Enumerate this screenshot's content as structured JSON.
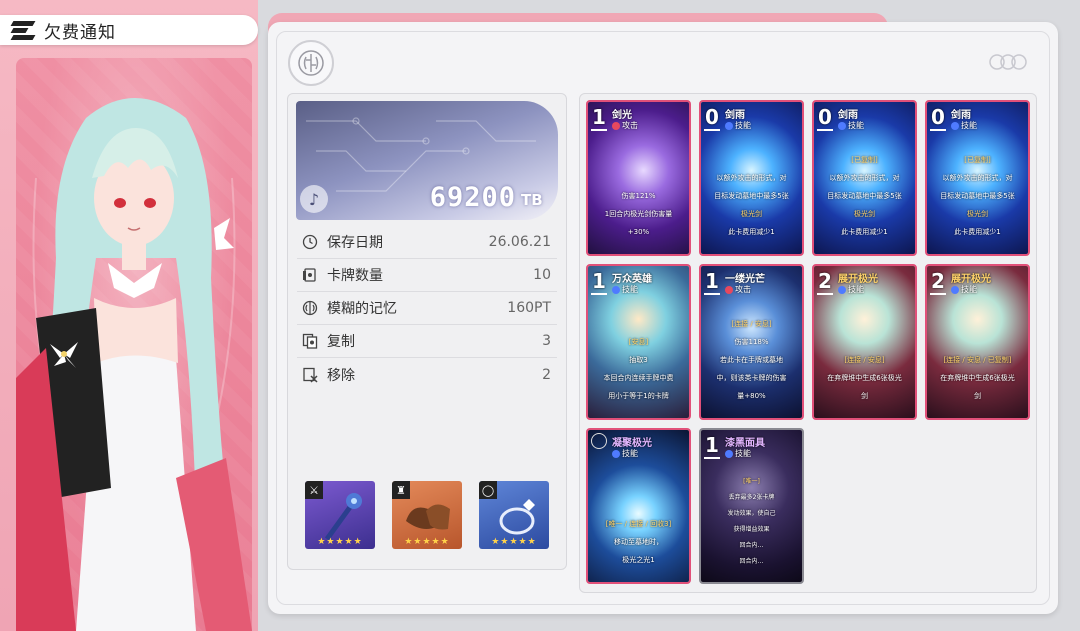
{
  "title_bar": {
    "title": "欠费通知"
  },
  "money": {
    "amount": "69200",
    "unit": "TB"
  },
  "stats": [
    {
      "icon": "clock-icon",
      "label": "保存日期",
      "value": "26.06.21"
    },
    {
      "icon": "card-count-icon",
      "label": "卡牌数量",
      "value": "10"
    },
    {
      "icon": "brain-icon",
      "label": "模糊的记忆",
      "value": "160PT"
    },
    {
      "icon": "copy-icon",
      "label": "复制",
      "value": "3"
    },
    {
      "icon": "remove-icon",
      "label": "移除",
      "value": "2"
    }
  ],
  "equipment": [
    {
      "name": "weapon",
      "icon": "sword-icon",
      "stars": "★★★★★"
    },
    {
      "name": "armor",
      "icon": "armor-icon",
      "stars": "★★★★★"
    },
    {
      "name": "ring",
      "icon": "ring-icon",
      "stars": "★★★★★"
    }
  ],
  "cards": [
    {
      "cost": "1",
      "name": "剑光",
      "type": "攻击",
      "type_kind": "attack",
      "desc_lines": [
        "伤害121%",
        "1回合内极光剑伤害量",
        "+30%"
      ]
    },
    {
      "cost": "0",
      "name": "剑雨",
      "type": "技能",
      "type_kind": "skill",
      "desc_lines": [
        "以额外攻击的形式，对",
        "目标发动墓地中最多5张",
        "极光剑",
        "此卡费用减少1"
      ]
    },
    {
      "cost": "0",
      "name": "剑雨",
      "type": "技能",
      "type_kind": "skill",
      "desc_lines": [
        "[已复制]",
        "以额外攻击的形式，对",
        "目标发动墓地中最多5张",
        "极光剑",
        "此卡费用减少1"
      ]
    },
    {
      "cost": "0",
      "name": "剑雨",
      "type": "技能",
      "type_kind": "skill",
      "desc_lines": [
        "[已复制]",
        "以额外攻击的形式，对",
        "目标发动墓地中最多5张",
        "极光剑",
        "此卡费用减少1"
      ]
    },
    {
      "cost": "1",
      "name": "万众英雄",
      "type": "技能",
      "type_kind": "skill",
      "desc_lines": [
        "[安息]",
        "抽取3",
        "本回合内连续手牌中费",
        "用小于等于1的卡牌"
      ]
    },
    {
      "cost": "1",
      "name": "一缕光芒",
      "type": "攻击",
      "type_kind": "attack",
      "desc_lines": [
        "[连接 / 安息]",
        "伤害118%",
        "若此卡在手牌或墓地",
        "中，则该类卡牌的伤害",
        "量+80%"
      ]
    },
    {
      "cost": "2",
      "name": "展开极光",
      "type": "技能",
      "type_kind": "skill",
      "desc_lines": [
        "[连接 / 安息]",
        "在弃牌堆中生成6张极光",
        "剑"
      ]
    },
    {
      "cost": "2",
      "name": "展开极光",
      "type": "技能",
      "type_kind": "skill",
      "desc_lines": [
        "[连接 / 安息 / 已复制]",
        "在弃牌堆中生成6张极光",
        "剑"
      ]
    },
    {
      "cost": "",
      "name": "凝聚极光",
      "type": "技能",
      "type_kind": "skill",
      "desc_lines": [
        "[唯一 / 连接 / 回收3]",
        "移动至墓地时，",
        "极光之光1"
      ]
    },
    {
      "cost": "1",
      "name": "漆黑面具",
      "type": "技能",
      "type_kind": "skill",
      "desc_lines": [
        "[唯一]",
        "丢弃最多2张卡牌",
        "发动效果，使自己",
        "获得增益效果",
        "回合内…",
        "回合内…"
      ]
    }
  ]
}
